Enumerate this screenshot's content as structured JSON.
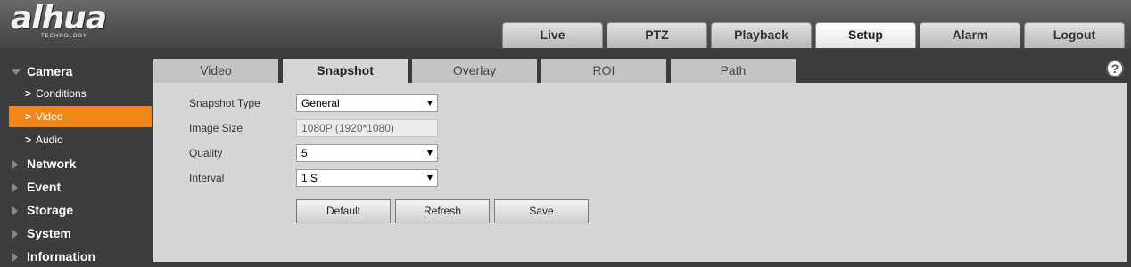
{
  "logo": {
    "text": "alhua",
    "subtext": "TECHNOLOGY"
  },
  "nav": {
    "tabs": [
      {
        "label": "Live"
      },
      {
        "label": "PTZ"
      },
      {
        "label": "Playback"
      },
      {
        "label": "Setup",
        "active": true
      },
      {
        "label": "Alarm"
      },
      {
        "label": "Logout"
      }
    ]
  },
  "sidebar": {
    "camera": "Camera",
    "conditions": "Conditions",
    "video": "Video",
    "audio": "Audio",
    "network": "Network",
    "event": "Event",
    "storage": "Storage",
    "system": "System",
    "information": "Information"
  },
  "subtabs": {
    "video": "Video",
    "snapshot": "Snapshot",
    "overlay": "Overlay",
    "roi": "ROI",
    "path": "Path"
  },
  "help": "?",
  "form": {
    "snapshot_type": {
      "label": "Snapshot Type",
      "value": "General"
    },
    "image_size": {
      "label": "Image Size",
      "value": "1080P (1920*1080)"
    },
    "quality": {
      "label": "Quality",
      "value": "5"
    },
    "interval": {
      "label": "Interval",
      "value": "1 S"
    }
  },
  "buttons": {
    "default": "Default",
    "refresh": "Refresh",
    "save": "Save"
  },
  "colors": {
    "accent": "#f0851b",
    "panel": "#d6d6d6",
    "sidebar": "#3c3c3c"
  }
}
